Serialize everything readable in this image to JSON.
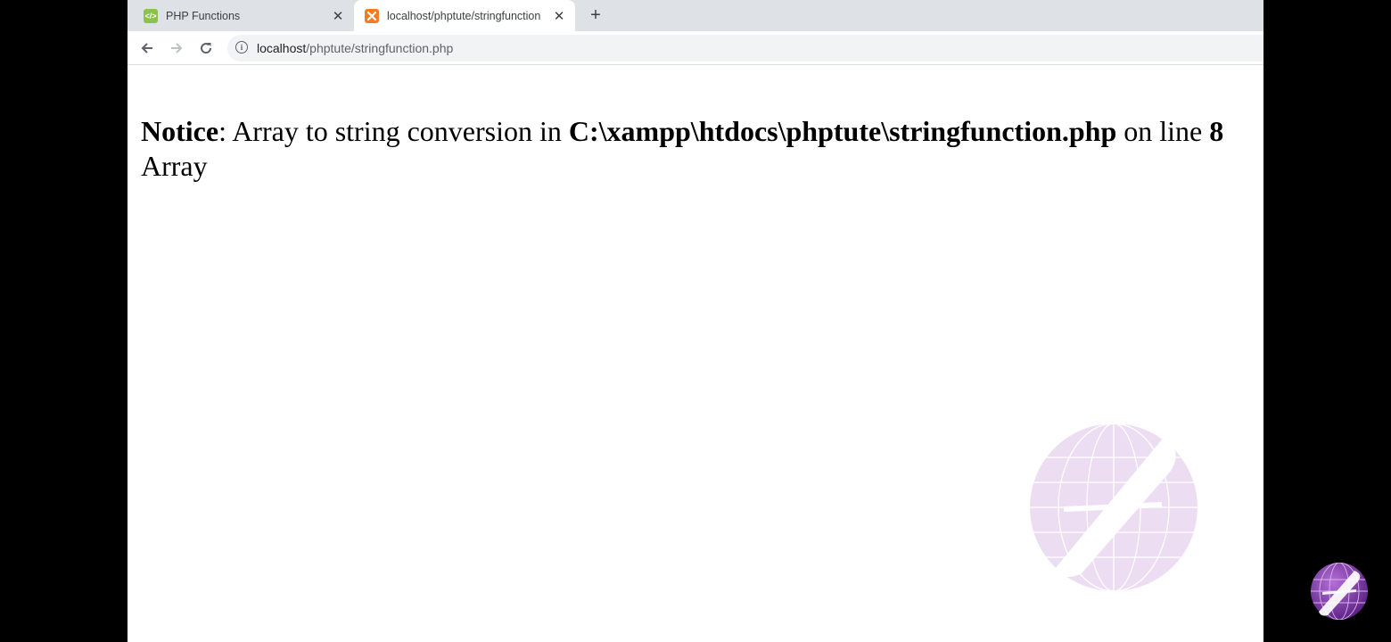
{
  "tabs": [
    {
      "title": "PHP Functions",
      "favicon": "code-favicon-icon",
      "active": false
    },
    {
      "title": "localhost/phptute/stringfunction",
      "favicon": "xampp-favicon-icon",
      "active": true
    }
  ],
  "new_tab_label": "+",
  "toolbar": {
    "url_host": "localhost",
    "url_path": "/phptute/stringfunction.php"
  },
  "page": {
    "notice_label": "Notice",
    "notice_message": ": Array to string conversion in ",
    "notice_file": "C:\\xampp\\htdocs\\phptute\\stringfunction.php",
    "notice_on_line": " on line ",
    "notice_line_number": "8",
    "output_text": "Array"
  },
  "colors": {
    "tabstrip_bg": "#dee1e6",
    "omnibox_bg": "#f1f3f4",
    "watermark": "#e6d3ee",
    "logo": "#7a3a9e"
  }
}
